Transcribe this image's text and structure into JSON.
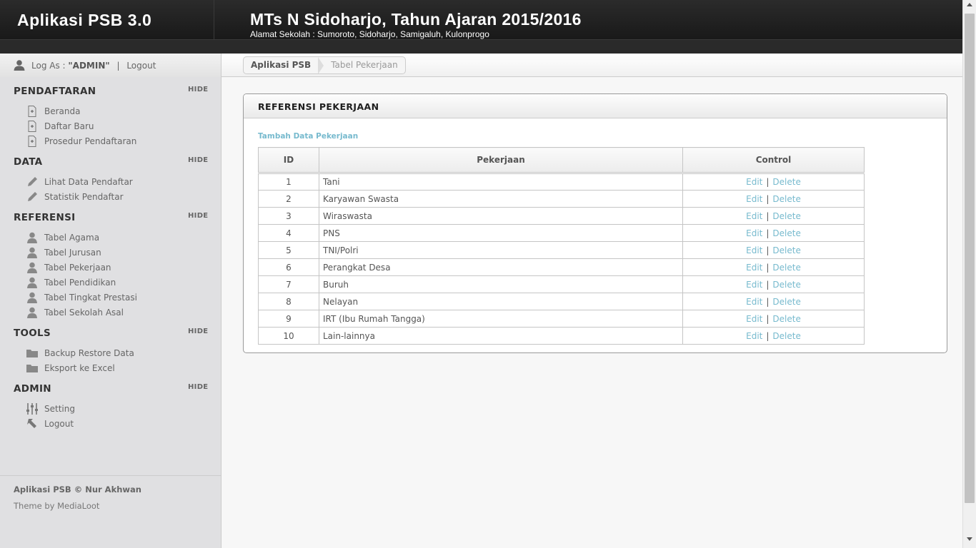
{
  "header": {
    "app_title": "Aplikasi PSB 3.0",
    "school_title": "MTs N Sidoharjo, Tahun Ajaran 2015/2016",
    "school_address": "Alamat Sekolah : Sumoroto, Sidoharjo, Samigaluh, Kulonprogo"
  },
  "user": {
    "log_as_label": "Log As :",
    "username": "\"ADMIN\"",
    "separator": "|",
    "logout_label": "Logout",
    "icon": "user-icon"
  },
  "breadcrumb": {
    "items": [
      "Aplikasi PSB",
      "Tabel Pekerjaan"
    ]
  },
  "sidebar": {
    "hide_label": "HIDE",
    "sections": [
      {
        "title": "PENDAFTARAN",
        "items": [
          {
            "label": "Beranda",
            "icon": "page-add-icon"
          },
          {
            "label": "Daftar Baru",
            "icon": "page-add-icon"
          },
          {
            "label": "Prosedur Pendaftaran",
            "icon": "page-add-icon"
          }
        ]
      },
      {
        "title": "DATA",
        "items": [
          {
            "label": "Lihat Data Pendaftar",
            "icon": "pencil-icon"
          },
          {
            "label": "Statistik Pendaftar",
            "icon": "pencil-icon"
          }
        ]
      },
      {
        "title": "REFERENSI",
        "items": [
          {
            "label": "Tabel Agama",
            "icon": "person-icon"
          },
          {
            "label": "Tabel Jurusan",
            "icon": "person-icon"
          },
          {
            "label": "Tabel Pekerjaan",
            "icon": "person-icon"
          },
          {
            "label": "Tabel Pendidikan",
            "icon": "person-icon"
          },
          {
            "label": "Tabel Tingkat Prestasi",
            "icon": "person-icon"
          },
          {
            "label": "Tabel Sekolah Asal",
            "icon": "person-icon"
          }
        ]
      },
      {
        "title": "TOOLS",
        "items": [
          {
            "label": "Backup Restore Data",
            "icon": "folder-icon"
          },
          {
            "label": "Eksport ke Excel",
            "icon": "folder-icon"
          }
        ]
      },
      {
        "title": "ADMIN",
        "items": [
          {
            "label": "Setting",
            "icon": "sliders-icon"
          },
          {
            "label": "Logout",
            "icon": "logout-arrow-icon"
          }
        ]
      }
    ],
    "footer_copy": "Aplikasi PSB © Nur Akhwan",
    "footer_theme": "Theme by MediaLoot"
  },
  "panel": {
    "title": "REFERENSI PEKERJAAN",
    "add_link": "Tambah Data Pekerjaan",
    "columns": [
      "ID",
      "Pekerjaan",
      "Control"
    ],
    "edit_label": "Edit",
    "delete_label": "Delete",
    "pipe": "|",
    "rows": [
      {
        "id": "1",
        "job": "Tani"
      },
      {
        "id": "2",
        "job": "Karyawan Swasta"
      },
      {
        "id": "3",
        "job": "Wiraswasta"
      },
      {
        "id": "4",
        "job": "PNS"
      },
      {
        "id": "5",
        "job": "TNI/Polri"
      },
      {
        "id": "6",
        "job": "Perangkat Desa"
      },
      {
        "id": "7",
        "job": "Buruh"
      },
      {
        "id": "8",
        "job": "Nelayan"
      },
      {
        "id": "9",
        "job": "IRT (Ibu Rumah Tangga)"
      },
      {
        "id": "10",
        "job": "Lain-lainnya"
      }
    ]
  },
  "colors": {
    "link": "#77bace",
    "header_bg": "#222222",
    "sidebar_bg": "#e0e0e2"
  }
}
